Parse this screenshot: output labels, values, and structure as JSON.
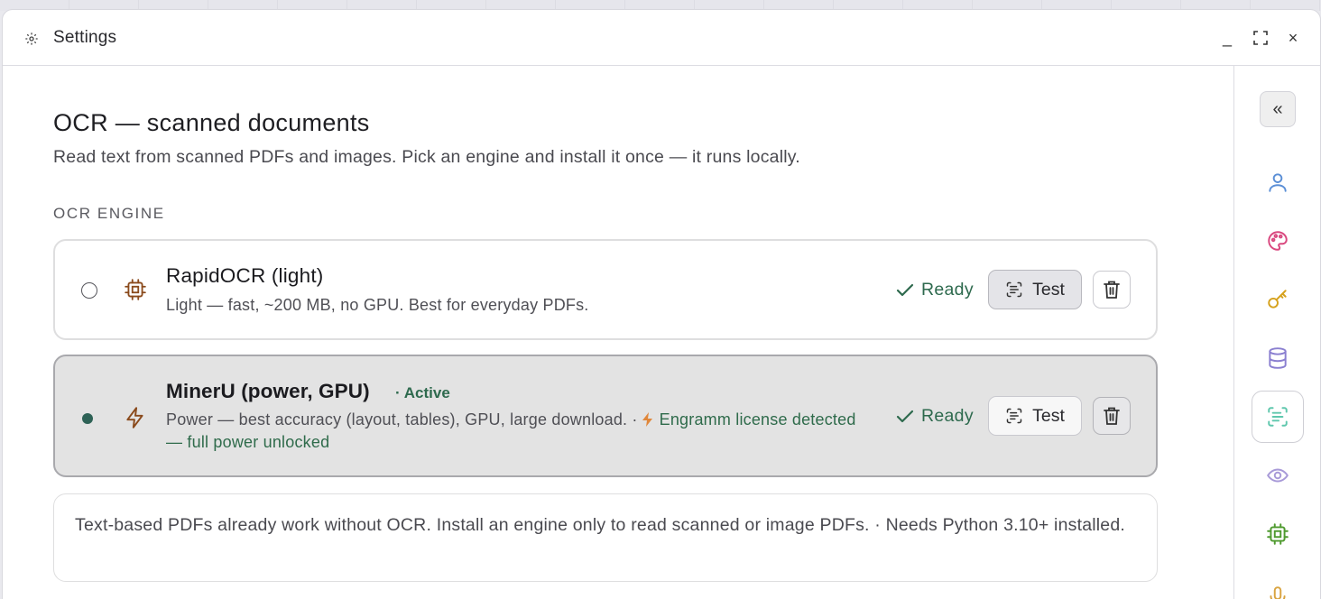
{
  "window": {
    "title": "Settings",
    "icons": {
      "title": "settings-gear-icon",
      "minimize": "minimize-icon",
      "maximize": "expand-icon",
      "close": "close-icon"
    },
    "controls": {
      "minimize": "_",
      "close": "×"
    }
  },
  "page": {
    "title": "OCR — scanned documents",
    "subtitle": "Read text from scanned PDFs and images. Pick an engine and install it once — it runs locally.",
    "section_label": "OCR ENGINE"
  },
  "engines": [
    {
      "name": "RapidOCR (light)",
      "description": "Light — fast, ~200 MB, no GPU. Best for everyday PDFs.",
      "status": "Ready",
      "test_label": "Test",
      "selected": false,
      "icon": "chip-icon"
    },
    {
      "name": "MinerU (power, GPU)",
      "active_tag": "· Active",
      "description": "Power — best accuracy (layout, tables), GPU, large download. ·",
      "license_text": "Engramm license detected — full power unlocked",
      "status": "Ready",
      "test_label": "Test",
      "selected": true,
      "icon": "lightning-icon"
    }
  ],
  "note": "Text-based PDFs already work without OCR. Install an engine only to read scanned or image PDFs. · Needs Python 3.10+ installed.",
  "rail": {
    "collapse_label": "«",
    "items": [
      {
        "icon": "user-icon",
        "color": "#5b8fd6"
      },
      {
        "icon": "palette-icon",
        "color": "#d9487f"
      },
      {
        "icon": "key-icon",
        "color": "#d6a21e"
      },
      {
        "icon": "database-icon",
        "color": "#8a7fd0"
      },
      {
        "icon": "scan-text-icon",
        "color": "#5fc7ad",
        "selected": true
      },
      {
        "icon": "eye-icon",
        "color": "#a89ad8"
      },
      {
        "icon": "chip-icon",
        "color": "#4f9a2f"
      },
      {
        "icon": "microphone-icon",
        "color": "#d9a441"
      }
    ]
  },
  "colors": {
    "accent_green": "#2e6a4e",
    "selected_dot": "#2e6256",
    "lightning_orange": "#e0873b",
    "engine_icon_brown": "#8a4a1c"
  }
}
